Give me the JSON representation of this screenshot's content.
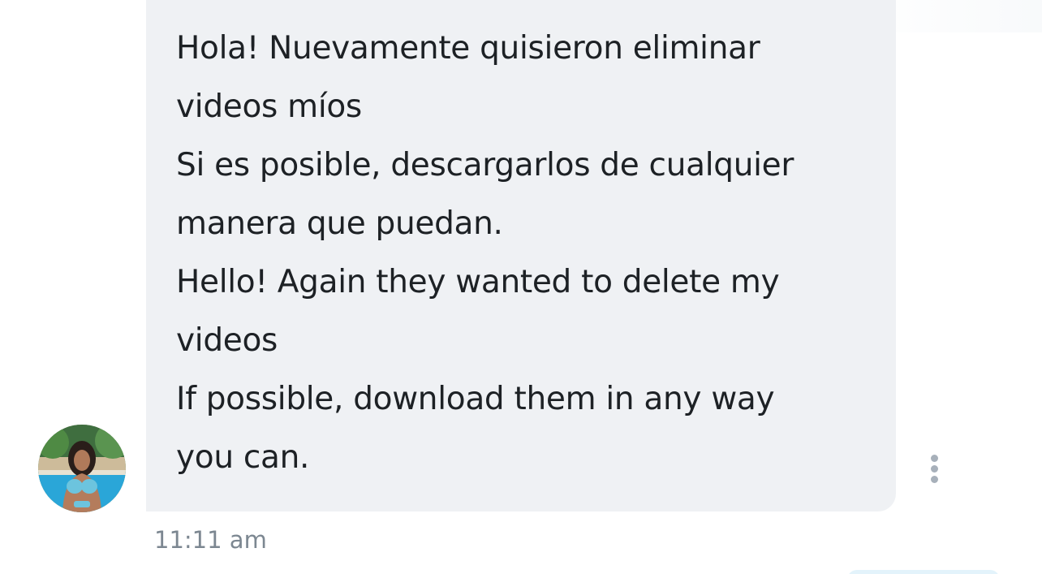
{
  "conversation": {
    "message": {
      "lines": [
        "Hola! Nuevamente quisieron eliminar",
        "videos míos",
        "Si es posible, descargarlos de cualquier",
        "manera que puedan.",
        "Hello! Again they wanted to delete my",
        "videos",
        "If possible, download them in any way",
        "you can."
      ],
      "timestamp": "11:11 am",
      "more_icon": "more-vertical-icon"
    },
    "sender": {
      "avatar_icon": "avatar-photo"
    }
  },
  "colors": {
    "bubble_background": "#eff1f4",
    "message_text": "#1d2125",
    "timestamp_text": "#7c8791",
    "more_icon": "#a7b0ba",
    "next_bubble": "#e3f3fb"
  }
}
